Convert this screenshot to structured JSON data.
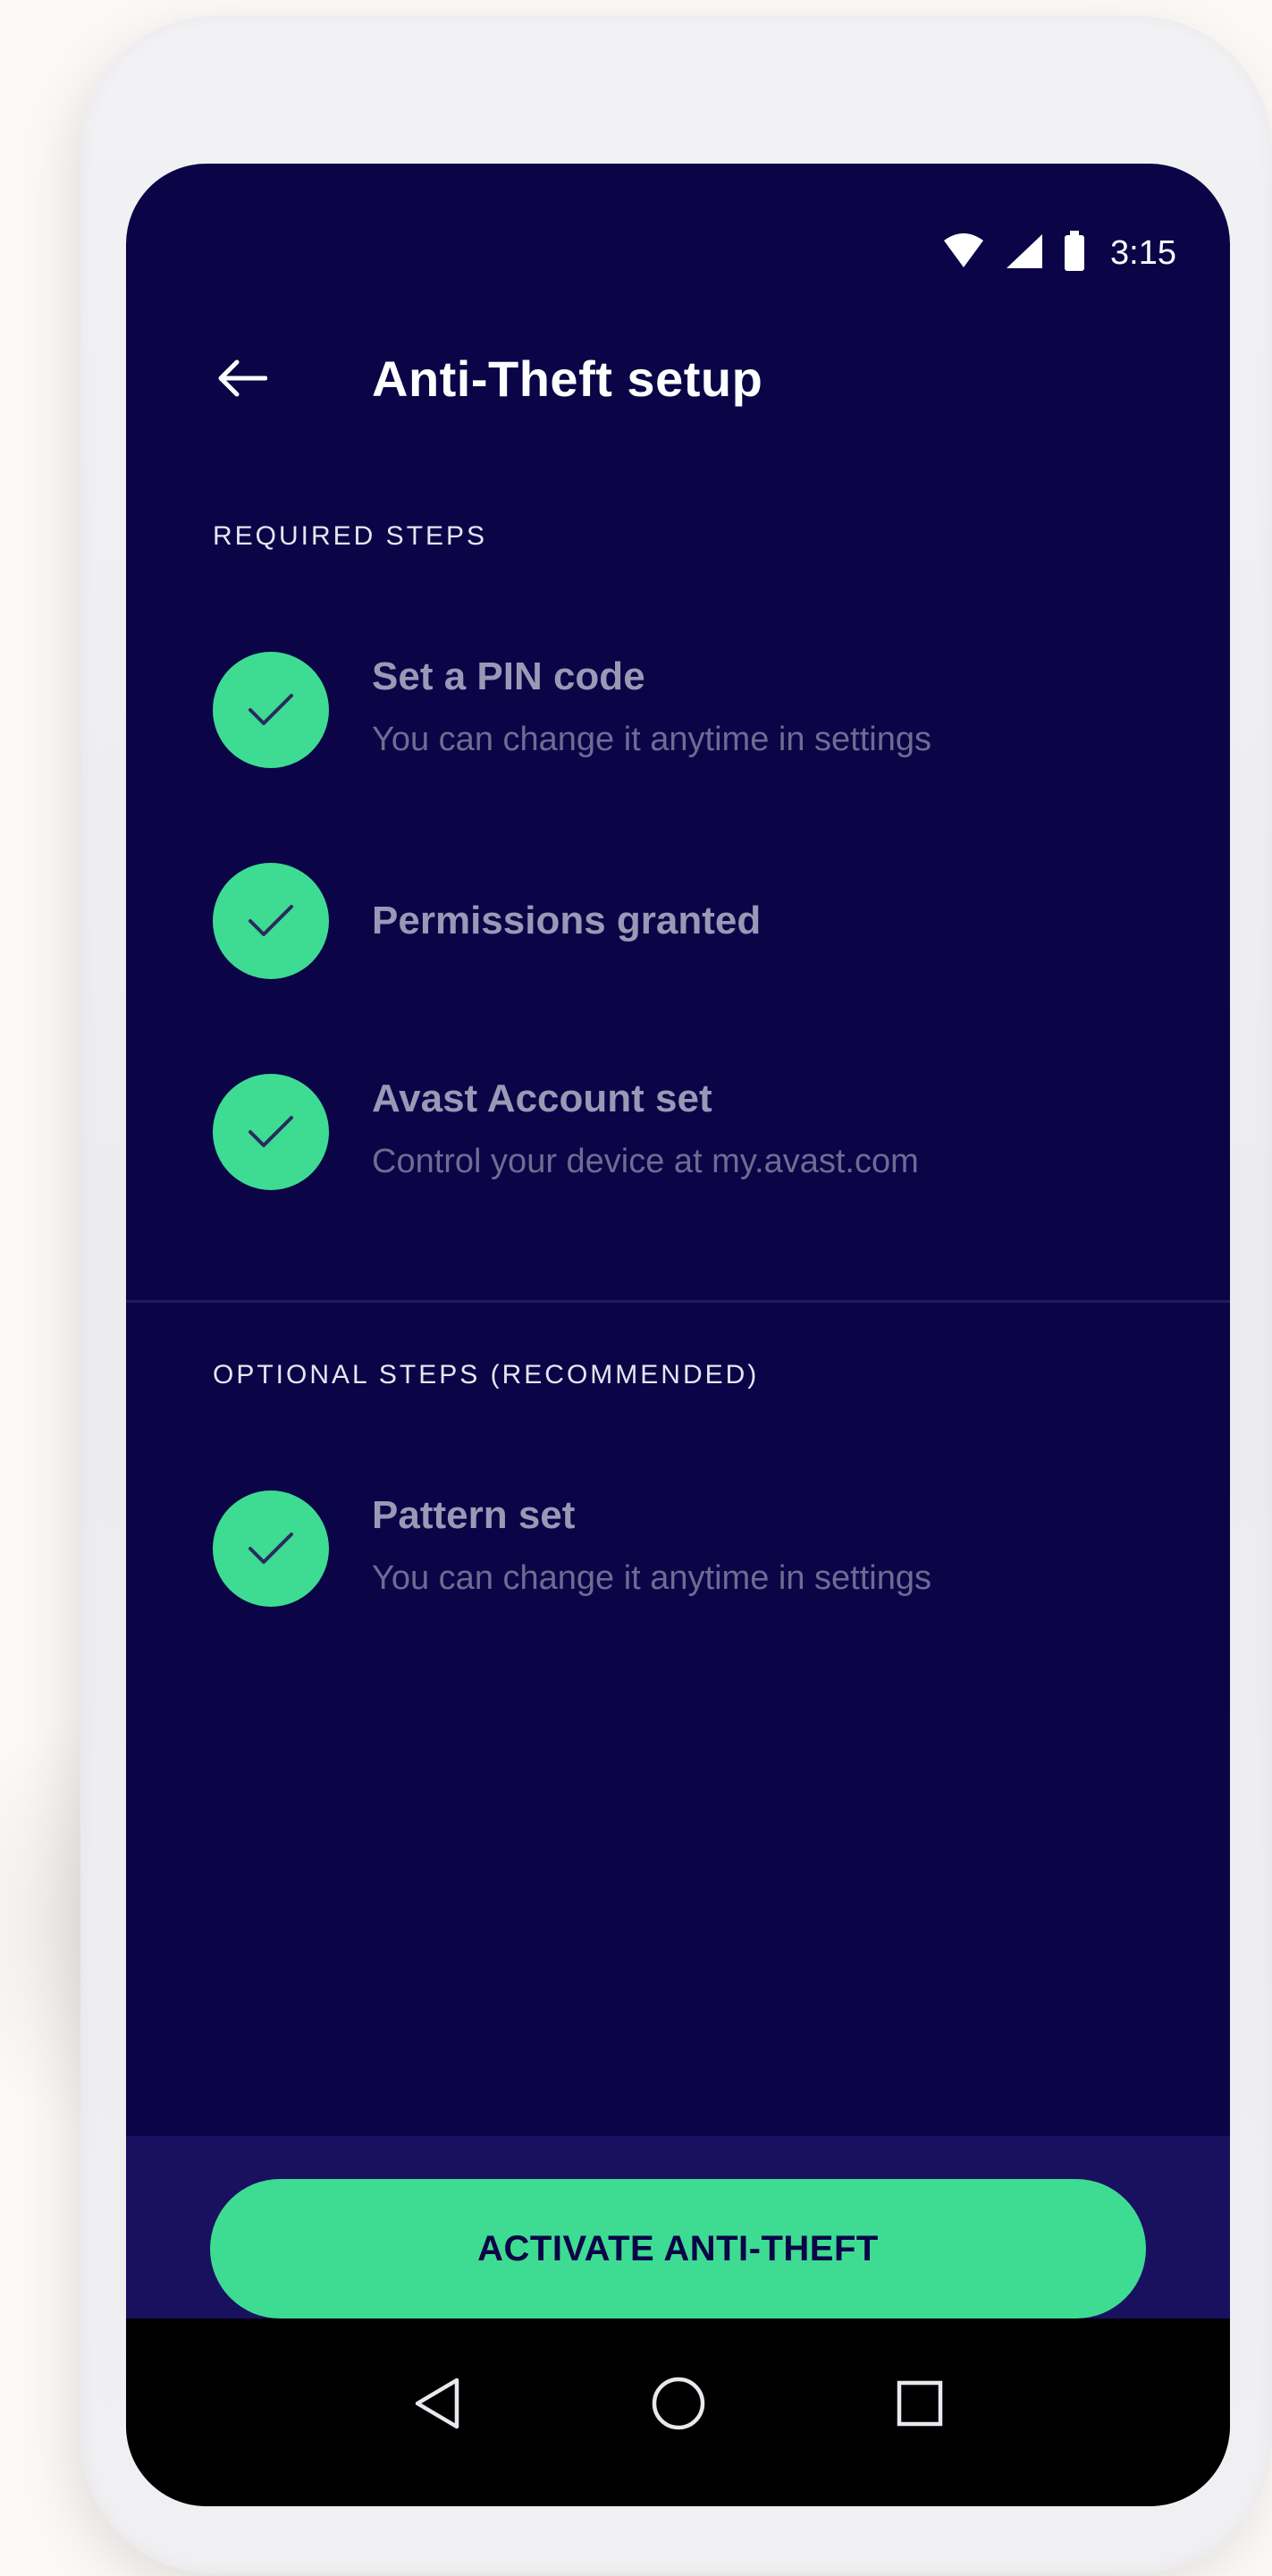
{
  "status_bar": {
    "time": "3:15",
    "icons": [
      "wifi-icon",
      "cellular-signal-icon",
      "battery-icon"
    ]
  },
  "header": {
    "back_icon": "back-arrow-icon",
    "title": "Anti-Theft setup"
  },
  "required_section": {
    "label": "REQUIRED STEPS",
    "steps": [
      {
        "title": "Set a PIN code",
        "subtitle": "You can change it anytime in settings",
        "completed": true
      },
      {
        "title": "Permissions granted",
        "subtitle": "",
        "completed": true
      },
      {
        "title": "Avast Account set",
        "subtitle": "Control your device at my.avast.com",
        "completed": true
      }
    ]
  },
  "optional_section": {
    "label": "OPTIONAL STEPS (RECOMMENDED)",
    "steps": [
      {
        "title": "Pattern set",
        "subtitle": "You can change it anytime in settings",
        "completed": true
      }
    ]
  },
  "footer": {
    "cta_label": "ACTIVATE ANTI-THEFT"
  },
  "nav_bar": {
    "icons": [
      "nav-back-icon",
      "nav-home-icon",
      "nav-recents-icon"
    ]
  },
  "colors": {
    "screen_background": "#0b0447",
    "accent_green": "#3ddc92",
    "footer_background": "#1a1060",
    "nav_background": "#000000"
  }
}
